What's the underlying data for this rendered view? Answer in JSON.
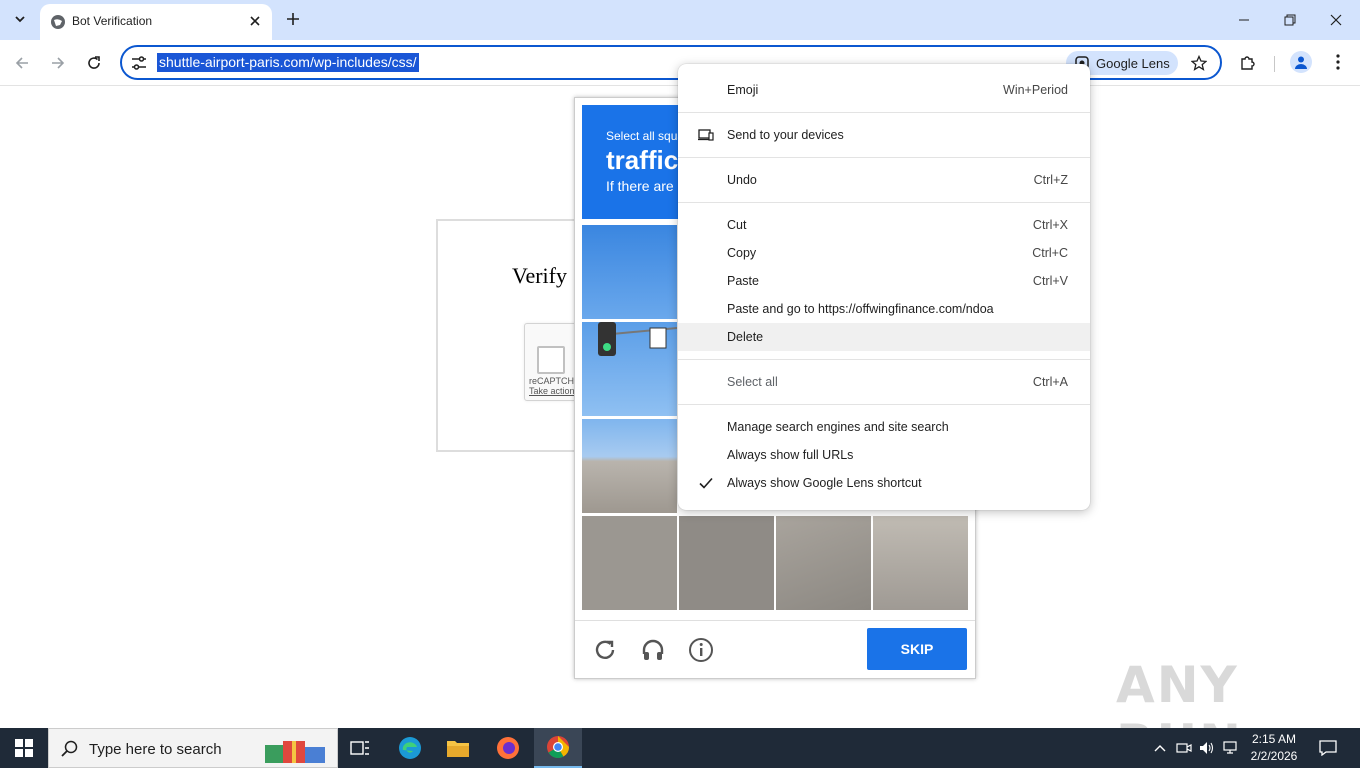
{
  "browser": {
    "tab_title": "Bot Verification",
    "url": "shuttle-airport-paris.com/wp-includes/css/",
    "lens_chip": "Google Lens"
  },
  "page": {
    "heading": "Verify",
    "recaptcha_label": "reCAPTCHA",
    "recaptcha_action": "Take action"
  },
  "challenge": {
    "instruction_line1": "Select all squa",
    "keyword": "traffic",
    "instruction_line2": "If there are n",
    "skip_label": "SKIP"
  },
  "context_menu": {
    "items": [
      {
        "label": "Emoji",
        "shortcut": "Win+Period"
      },
      {
        "label": "Send to your devices",
        "shortcut": ""
      },
      {
        "label": "Undo",
        "shortcut": "Ctrl+Z"
      },
      {
        "label": "Cut",
        "shortcut": "Ctrl+X"
      },
      {
        "label": "Copy",
        "shortcut": "Ctrl+C"
      },
      {
        "label": "Paste",
        "shortcut": "Ctrl+V"
      },
      {
        "label": "Paste and go to https://offwingfinance.com/ndoa",
        "shortcut": ""
      },
      {
        "label": "Delete",
        "shortcut": ""
      },
      {
        "label": "Select all",
        "shortcut": "Ctrl+A"
      },
      {
        "label": "Manage search engines and site search",
        "shortcut": ""
      },
      {
        "label": "Always show full URLs",
        "shortcut": ""
      },
      {
        "label": "Always show Google Lens shortcut",
        "shortcut": ""
      }
    ]
  },
  "watermark": "ANY RUN",
  "taskbar": {
    "search_placeholder": "Type here to search",
    "time": "2:15 AM",
    "date": "2/2/2026"
  },
  "colors": {
    "accent": "#1a73e8",
    "tabstrip": "#d3e3fd",
    "taskbar": "#1f2a38"
  }
}
